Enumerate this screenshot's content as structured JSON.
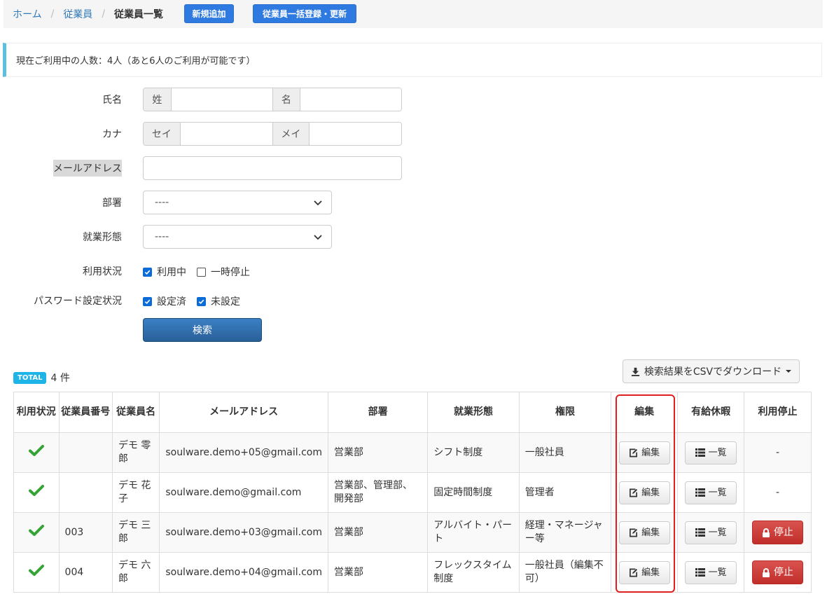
{
  "breadcrumb": {
    "home": "ホーム",
    "employees": "従業員",
    "current": "従業員一覧"
  },
  "buttons": {
    "new": "新規追加",
    "bulk": "従業員一括登録・更新",
    "search": "検索",
    "csv": "検索結果をCSVでダウンロード"
  },
  "info": "現在ご利用中の人数：4人（あと6人のご利用が可能です）",
  "form": {
    "name_label": "氏名",
    "last_name_addon": "姓",
    "first_name_addon": "名",
    "kana_label": "カナ",
    "last_kana_addon": "セイ",
    "first_kana_addon": "メイ",
    "email_label": "メールアドレス",
    "dept_label": "部署",
    "dept_value": "----",
    "employment_label": "就業形態",
    "employment_value": "----",
    "status_label": "利用状況",
    "status_active": "利用中",
    "status_paused": "一時停止",
    "password_label": "パスワード設定状況",
    "pw_set": "設定済",
    "pw_unset": "未設定"
  },
  "total": {
    "badge": "TOTAL",
    "count": "4 件"
  },
  "table": {
    "headers": {
      "status": "利用状況",
      "number": "従業員番号",
      "name": "従業員名",
      "email": "メールアドレス",
      "dept": "部署",
      "employment": "就業形態",
      "role": "権限",
      "edit": "編集",
      "leave": "有給休暇",
      "stop": "利用停止"
    },
    "edit_label": "編集",
    "list_label": "一覧",
    "stop_label": "停止",
    "dash": "-",
    "rows": [
      {
        "number": "",
        "name": "デモ 零郎",
        "email": "soulware.demo+05@gmail.com",
        "dept": "営業部",
        "employment": "シフト制度",
        "role": "一般社員"
      },
      {
        "number": "",
        "name": "デモ 花子",
        "email": "soulware.demo@gmail.com",
        "dept": "営業部、管理部、開発部",
        "employment": "固定時間制度",
        "role": "管理者"
      },
      {
        "number": "003",
        "name": "デモ 三郎",
        "email": "soulware.demo+03@gmail.com",
        "dept": "営業部",
        "employment": "アルバイト・パート",
        "role": "経理・マネージャー等"
      },
      {
        "number": "004",
        "name": "デモ 六郎",
        "email": "soulware.demo+04@gmail.com",
        "dept": "営業部",
        "employment": "フレックスタイム制度",
        "role": "一般社員（編集不可）"
      }
    ]
  }
}
